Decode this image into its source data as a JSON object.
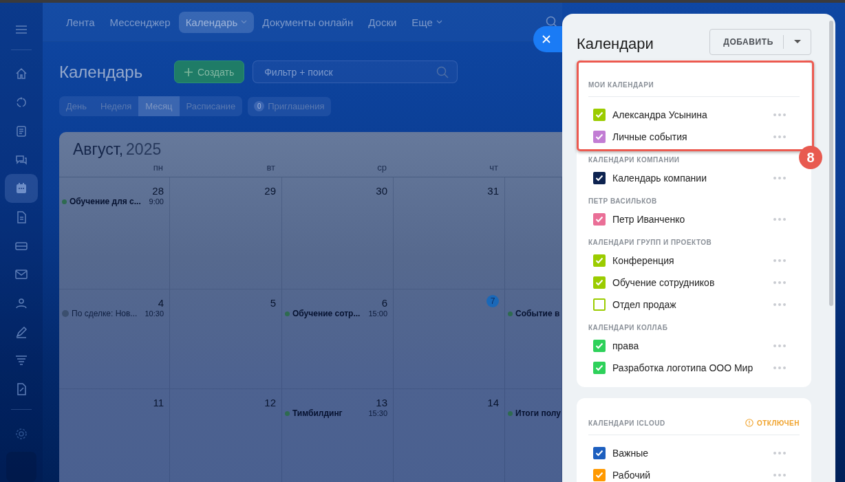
{
  "sidebar": {
    "items": [
      {
        "selected": false
      },
      {
        "selected": false
      },
      {
        "selected": false
      },
      {
        "selected": false
      },
      {
        "selected": true
      },
      {
        "selected": false
      },
      {
        "selected": false
      },
      {
        "selected": false
      },
      {
        "selected": false
      },
      {
        "selected": false
      },
      {
        "selected": false
      },
      {
        "selected": false
      }
    ]
  },
  "top_nav": {
    "items": [
      {
        "label": "Лента",
        "selected": false,
        "dropdown": false
      },
      {
        "label": "Мессенджер",
        "selected": false,
        "dropdown": false
      },
      {
        "label": "Календарь",
        "selected": true,
        "dropdown": true
      },
      {
        "label": "Документы онлайн",
        "selected": false,
        "dropdown": false
      },
      {
        "label": "Доски",
        "selected": false,
        "dropdown": false
      },
      {
        "label": "Еще",
        "selected": false,
        "dropdown": true
      }
    ]
  },
  "page": {
    "title": "Календарь",
    "create_button": "Создать",
    "search": {
      "placeholder": "Фильтр + поиск"
    },
    "view_tabs": [
      {
        "label": "День",
        "selected": false
      },
      {
        "label": "Неделя",
        "selected": false
      },
      {
        "label": "Месяц",
        "selected": true
      },
      {
        "label": "Расписание",
        "selected": false
      }
    ],
    "invitations": {
      "count": "0",
      "label": "Приглашения"
    }
  },
  "calendar": {
    "month": "Август,",
    "year": "2025",
    "weekdays": [
      "пн",
      "вт",
      "ср",
      "чт"
    ],
    "weeks": [
      [
        {
          "day": "28",
          "today": false,
          "events": [
            {
              "kind": "event",
              "title": "Обучение для с...",
              "time": "9:00"
            }
          ]
        },
        {
          "day": "29",
          "today": false
        },
        {
          "day": "30",
          "today": false
        },
        {
          "day": "31",
          "today": false
        }
      ],
      [
        {
          "day": "4",
          "today": false,
          "events": [
            {
              "kind": "deal",
              "title": "По сделке: Нов...",
              "time": "10:30"
            }
          ]
        },
        {
          "day": "5",
          "today": false
        },
        {
          "day": "6",
          "today": false,
          "events": [
            {
              "kind": "event",
              "title": "Обучение сотр...",
              "time": "15:00"
            }
          ]
        },
        {
          "day": "7",
          "today": true
        },
        {
          "events": [
            {
              "kind": "event",
              "title": "Событие в"
            }
          ]
        }
      ],
      [
        {
          "day": "11",
          "today": false
        },
        {
          "day": "12",
          "today": false
        },
        {
          "day": "13",
          "today": false,
          "events": [
            {
              "kind": "event",
              "title": "Тимбилдинг",
              "time": "15:30"
            }
          ]
        },
        {
          "day": "14",
          "today": false
        },
        {
          "events": [
            {
              "kind": "event",
              "title": "Итоги полу"
            }
          ]
        }
      ]
    ]
  },
  "panel": {
    "title": "Календари",
    "add_button": "ДОБАВИТЬ",
    "cards": [
      {
        "groups": [
          {
            "heading": "МОИ КАЛЕНДАРИ",
            "divider": true,
            "items": [
              {
                "name": "Александра Усынина",
                "checked": true,
                "color": "#9bcc00"
              },
              {
                "name": "Личные события",
                "checked": true,
                "color": "#c27dd4"
              }
            ]
          },
          {
            "heading": "КАЛЕНДАРИ КОМПАНИИ",
            "divider": false,
            "items": [
              {
                "name": "Календарь компании",
                "checked": true,
                "color": "#0d2350"
              }
            ]
          },
          {
            "heading": "ПЕТР ВАСИЛЬКОВ",
            "divider": false,
            "items": [
              {
                "name": "Петр Иванченко",
                "checked": true,
                "color": "#ea6f97"
              }
            ]
          },
          {
            "heading": "КАЛЕНДАРИ ГРУПП И ПРОЕКТОВ",
            "divider": false,
            "items": [
              {
                "name": "Конференция",
                "checked": true,
                "color": "#9bcc00"
              },
              {
                "name": "Обучение сотрудников",
                "checked": true,
                "color": "#9bcc00"
              },
              {
                "name": "Отдел продаж",
                "checked": false,
                "color": "#9bcc00"
              }
            ]
          },
          {
            "heading": "КАЛЕНДАРИ КОЛЛАБ",
            "divider": false,
            "items": [
              {
                "name": "права",
                "checked": true,
                "color": "#2ed15a"
              },
              {
                "name": "Разработка логотипа ООО Мир",
                "checked": true,
                "color": "#2ed15a"
              }
            ]
          }
        ]
      },
      {
        "groups": [
          {
            "heading": "КАЛЕНДАРИ ICLOUD",
            "status": "ОТКЛЮЧЕН",
            "divider": true,
            "items": [
              {
                "name": "Важные",
                "checked": true,
                "color": "#1d5fbf"
              },
              {
                "name": "Рабочий",
                "checked": true,
                "color": "#ff9900"
              }
            ]
          }
        ]
      }
    ]
  },
  "annotation": {
    "label": "8"
  }
}
